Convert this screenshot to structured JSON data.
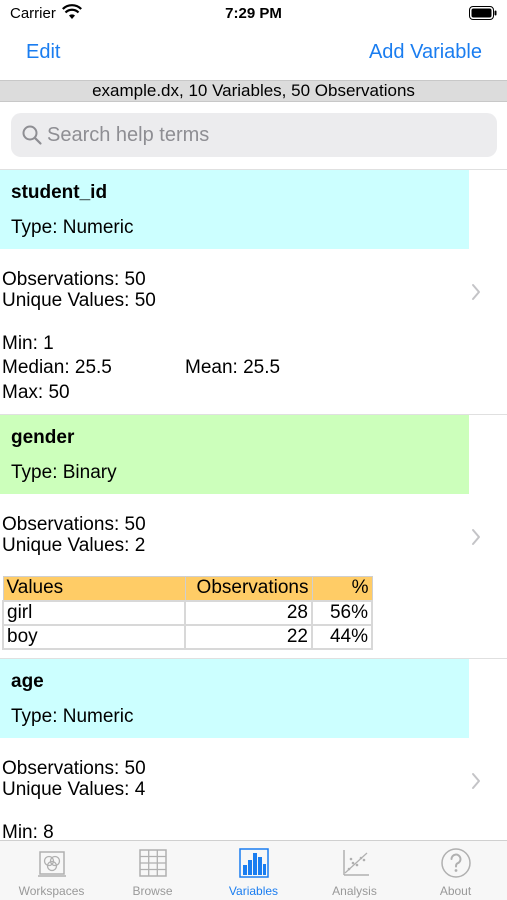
{
  "status_bar": {
    "carrier": "Carrier",
    "time": "7:29 PM"
  },
  "nav": {
    "edit_label": "Edit",
    "add_label": "Add Variable"
  },
  "dataset_summary": "example.dx, 10 Variables, 50 Observations",
  "search": {
    "placeholder": "Search help terms",
    "value": ""
  },
  "variables": [
    {
      "name": "student_id",
      "type": "Type: Numeric",
      "observations": "Observations: 50",
      "unique": "Unique Values: 50",
      "min": "Min: 1",
      "median": "Median: 25.5",
      "mean": "Mean: 25.5",
      "max": "Max: 50"
    },
    {
      "name": "gender",
      "type": "Type: Binary",
      "observations": "Observations: 50",
      "unique": "Unique Values: 2",
      "table": {
        "headers": [
          "Values",
          "Observations",
          "%"
        ],
        "rows": [
          [
            "girl",
            "28",
            "56%"
          ],
          [
            "boy",
            "22",
            "44%"
          ]
        ]
      }
    },
    {
      "name": "age",
      "type": "Type: Numeric",
      "observations": "Observations: 50",
      "unique": "Unique Values: 4",
      "min": "Min: 8"
    }
  ],
  "tabs": [
    {
      "label": "Workspaces",
      "icon": "workspaces-icon"
    },
    {
      "label": "Browse",
      "icon": "grid-icon"
    },
    {
      "label": "Variables",
      "icon": "bar-chart-icon",
      "active": true
    },
    {
      "label": "Analysis",
      "icon": "scatter-plot-icon"
    },
    {
      "label": "About",
      "icon": "help-icon"
    }
  ],
  "colors": {
    "accent": "#1a7df0",
    "numeric_header": "#ccffff",
    "binary_header": "#ccffbb",
    "table_header": "#ffcc66"
  }
}
